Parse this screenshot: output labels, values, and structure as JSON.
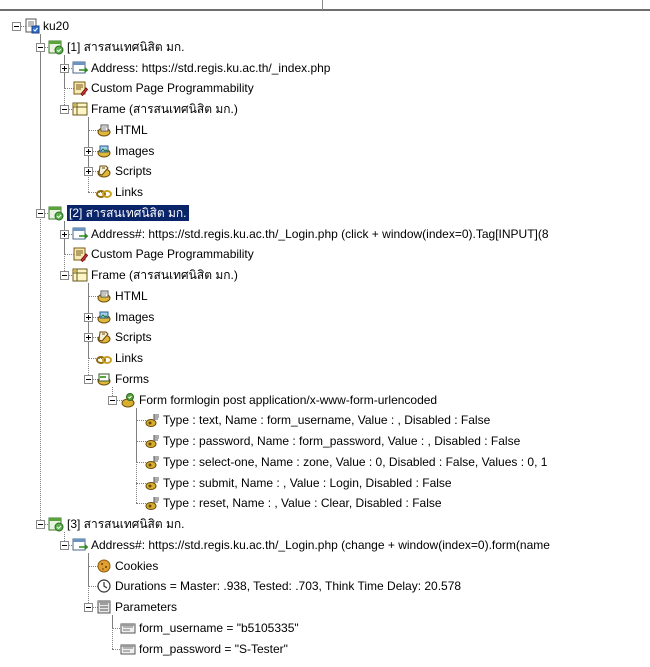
{
  "tree": {
    "root": "ku20",
    "items": [
      {
        "label": "[1] สารสนเทศนิสิต มก."
      },
      {
        "label": "Address: https://std.regis.ku.ac.th/_index.php"
      },
      {
        "label": "Custom Page Programmability"
      },
      {
        "label": "Frame (สารสนเทศนิสิต มก.)"
      },
      {
        "label": "HTML"
      },
      {
        "label": "Images"
      },
      {
        "label": "Scripts"
      },
      {
        "label": "Links"
      },
      {
        "label": "[2] สารสนเทศนิสิต มก."
      },
      {
        "label": "Address#: https://std.regis.ku.ac.th/_Login.php (click + window(index=0).Tag[INPUT](8"
      },
      {
        "label": "Custom Page Programmability"
      },
      {
        "label": "Frame (สารสนเทศนิสิต มก.)"
      },
      {
        "label": "HTML"
      },
      {
        "label": "Images"
      },
      {
        "label": "Scripts"
      },
      {
        "label": "Links"
      },
      {
        "label": "Forms"
      },
      {
        "label": "Form formlogin post    application/x-www-form-urlencoded"
      },
      {
        "label": "Type : text, Name : form_username, Value : , Disabled : False"
      },
      {
        "label": "Type : password, Name : form_password, Value : , Disabled : False"
      },
      {
        "label": "Type : select-one, Name : zone, Value : 0, Disabled : False, Values : 0, 1"
      },
      {
        "label": "Type : submit, Name : , Value : Login, Disabled : False"
      },
      {
        "label": "Type : reset, Name : , Value : Clear, Disabled : False"
      },
      {
        "label": "[3] สารสนเทศนิสิต มก."
      },
      {
        "label": "Address#: https://std.regis.ku.ac.th/_Login.php (change + window(index=0).form(name"
      },
      {
        "label": "Cookies"
      },
      {
        "label": "Durations = Master: .938, Tested: .703, Think Time Delay: 20.578"
      },
      {
        "label": "Parameters"
      },
      {
        "label": "form_username = \"b5105335\""
      },
      {
        "label": "form_password = \"S-Tester\""
      }
    ]
  }
}
